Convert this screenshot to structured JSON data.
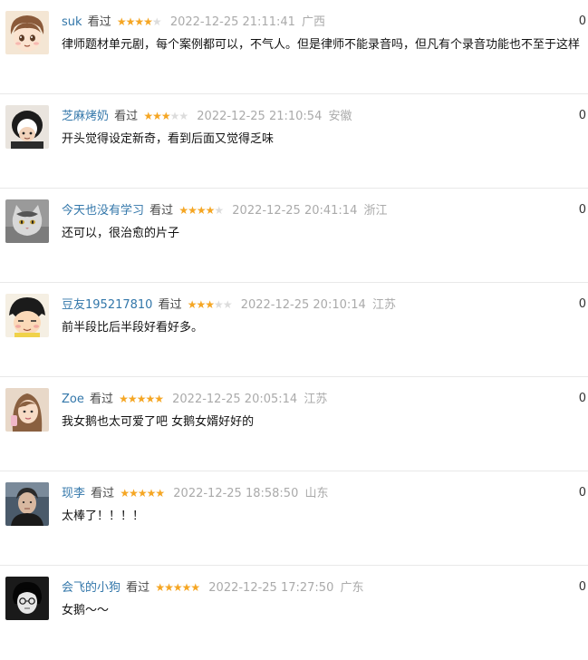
{
  "watched_label": "看过",
  "colors": {
    "username": "#3377aa",
    "star_on": "#f5a623",
    "star_off": "#dcdcdc",
    "meta": "#aaaaaa"
  },
  "reviews": [
    {
      "user": "suk",
      "rating": 4,
      "time": "2022-12-25 21:11:41",
      "location": "广西",
      "votes": "0",
      "content": "律师题材单元剧，每个案例都可以，不气人。但是律师不能录音吗，但凡有个录音功能也不至于这样"
    },
    {
      "user": "芝麻烤奶",
      "rating": 3,
      "time": "2022-12-25 21:10:54",
      "location": "安徽",
      "votes": "0",
      "content": "开头觉得设定新奇，看到后面又觉得乏味"
    },
    {
      "user": "今天也没有学习",
      "rating": 4,
      "time": "2022-12-25 20:41:14",
      "location": "浙江",
      "votes": "0",
      "content": "还可以，很治愈的片子"
    },
    {
      "user": "豆友195217810",
      "rating": 3,
      "time": "2022-12-25 20:10:14",
      "location": "江苏",
      "votes": "0",
      "content": "前半段比后半段好看好多。"
    },
    {
      "user": "Zoe",
      "rating": 5,
      "time": "2022-12-25 20:05:14",
      "location": "江苏",
      "votes": "0",
      "content": "我女鹅也太可爱了吧 女鹅女婿好好的"
    },
    {
      "user": "现李",
      "rating": 5,
      "time": "2022-12-25 18:58:50",
      "location": "山东",
      "votes": "0",
      "content": "太棒了！！！！"
    },
    {
      "user": "会飞的小狗",
      "rating": 5,
      "time": "2022-12-25 17:27:50",
      "location": "广东",
      "votes": "0",
      "content": "女鹅～～"
    }
  ]
}
